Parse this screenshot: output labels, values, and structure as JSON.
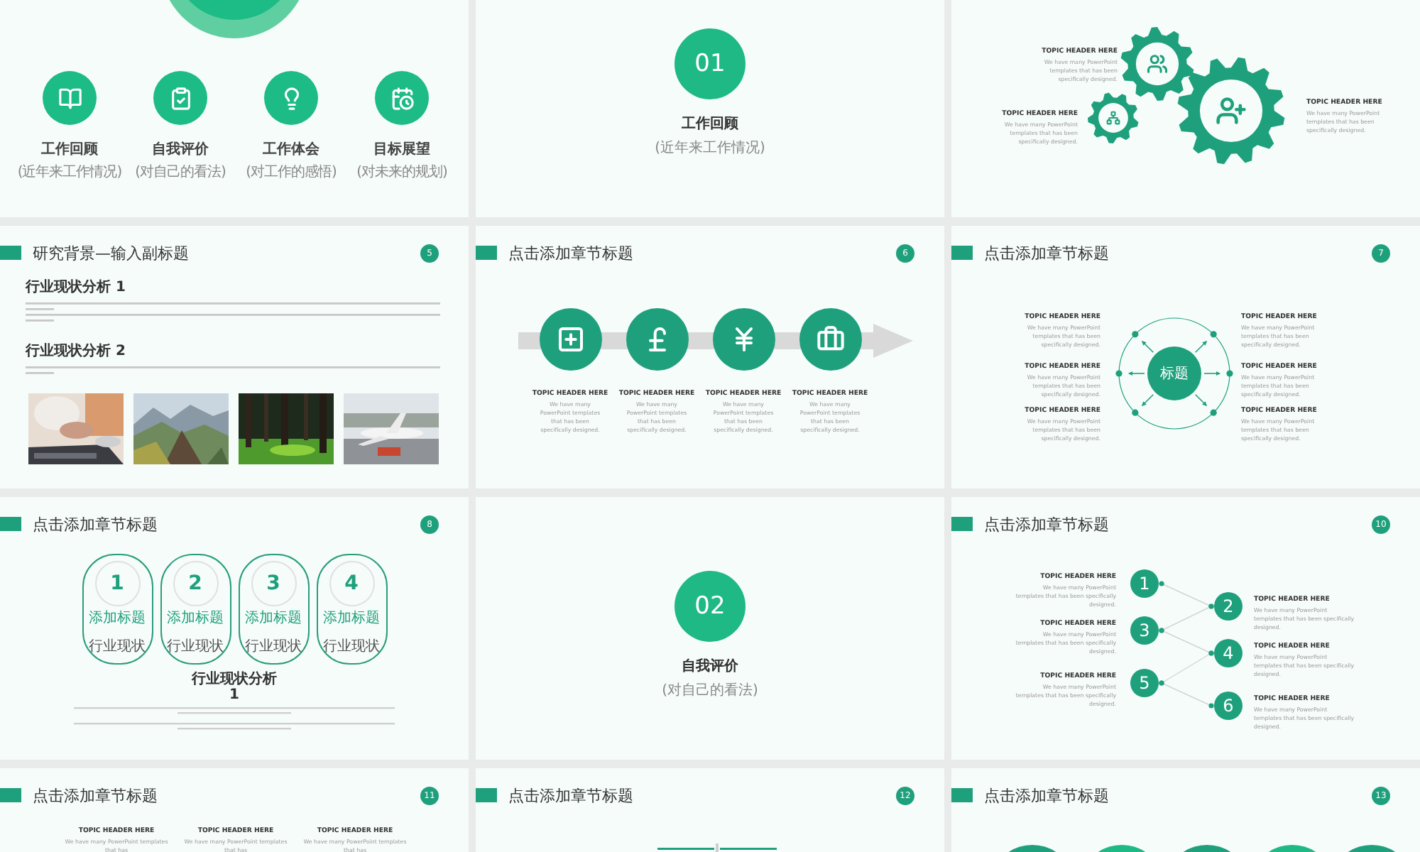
{
  "slides": [
    {
      "kind": "icons",
      "items": [
        {
          "title": "工作回顾",
          "subtitle": "(近年来工作情况)"
        },
        {
          "title": "自我评价",
          "subtitle": "(对自己的看法)"
        },
        {
          "title": "工作体会",
          "subtitle": "(对工作的感悟)"
        },
        {
          "title": "目标展望",
          "subtitle": "(对未来的规划)"
        }
      ]
    },
    {
      "kind": "section",
      "number": "01",
      "title": "工作回顾",
      "subtitle": "(近年来工作情况)"
    },
    {
      "kind": "gears",
      "topics": [
        {
          "header": "TOPIC HEADER HERE",
          "text": "We have many PowerPoint templates that has been specifically designed."
        },
        {
          "header": "TOPIC HEADER HERE",
          "text": "We have many PowerPoint templates that has been specifically designed."
        },
        {
          "header": "TOPIC HEADER HERE",
          "text": "We have many PowerPoint templates that has been specifically designed."
        }
      ]
    },
    {
      "kind": "text-photos",
      "title": "研究背景—输入副标题",
      "page": "5",
      "sections": [
        {
          "heading": "行业现状分析 1"
        },
        {
          "heading": "行业现状分析 2"
        }
      ],
      "photos": [
        {
          "kind": "picture"
        },
        {
          "kind": "picture"
        },
        {
          "kind": "picture"
        },
        {
          "kind": "picture"
        }
      ]
    },
    {
      "kind": "arrow",
      "title": "点击添加章节标题",
      "page": "6",
      "topics": [
        {
          "header": "TOPIC HEADER HERE",
          "text": "We have many PowerPoint templates that has been specifically designed."
        },
        {
          "header": "TOPIC HEADER HERE",
          "text": "We have many PowerPoint templates that has been specifically designed."
        },
        {
          "header": "TOPIC HEADER HERE",
          "text": "We have many PowerPoint templates that has been specifically designed."
        },
        {
          "header": "TOPIC HEADER HERE",
          "text": "We have many PowerPoint templates that has been specifically designed."
        }
      ]
    },
    {
      "kind": "hub",
      "title": "点击添加章节标题",
      "page": "7",
      "center": "标题",
      "topics": [
        {
          "header": "TOPIC HEADER HERE",
          "text": "We have many PowerPoint templates that has been specifically designed."
        },
        {
          "header": "TOPIC HEADER HERE",
          "text": "We have many PowerPoint templates that has been specifically designed."
        },
        {
          "header": "TOPIC HEADER HERE",
          "text": "We have many PowerPoint templates that has been specifically designed."
        },
        {
          "header": "TOPIC HEADER HERE",
          "text": "We have many PowerPoint templates that has been specifically designed."
        },
        {
          "header": "TOPIC HEADER HERE",
          "text": "We have many PowerPoint templates that has been specifically designed."
        },
        {
          "header": "TOPIC HEADER HERE",
          "text": "We have many PowerPoint templates that has been specifically designed."
        }
      ]
    },
    {
      "kind": "pills",
      "title": "点击添加章节标题",
      "page": "8",
      "pills": [
        {
          "number": "1",
          "caption": "添加标题",
          "label": "行业现状"
        },
        {
          "number": "2",
          "caption": "添加标题",
          "label": "行业现状"
        },
        {
          "number": "3",
          "caption": "添加标题",
          "label": "行业现状"
        },
        {
          "number": "4",
          "caption": "添加标题",
          "label": "行业现状"
        }
      ],
      "heading": "行业现状分析",
      "heading_number": "1"
    },
    {
      "kind": "section",
      "number": "02",
      "title": "自我评价",
      "subtitle": "(对自己的看法)"
    },
    {
      "kind": "zigzag",
      "title": "点击添加章节标题",
      "page": "10",
      "nodes": [
        {
          "number": "1",
          "header": "TOPIC HEADER HERE",
          "text": "We have many PowerPoint templates that has been specifically designed."
        },
        {
          "number": "2",
          "header": "TOPIC HEADER HERE",
          "text": "We have many PowerPoint templates that has been specifically designed."
        },
        {
          "number": "3",
          "header": "TOPIC HEADER HERE",
          "text": "We have many PowerPoint templates that has been specifically designed."
        },
        {
          "number": "4",
          "header": "TOPIC HEADER HERE",
          "text": "We have many PowerPoint templates that has been specifically designed."
        },
        {
          "number": "5",
          "header": "TOPIC HEADER HERE",
          "text": "We have many PowerPoint templates that has been specifically designed."
        },
        {
          "number": "6",
          "header": "TOPIC HEADER HERE",
          "text": "We have many PowerPoint templates that has been specifically designed."
        }
      ]
    },
    {
      "kind": "columns",
      "title": "点击添加章节标题",
      "page": "11",
      "topics": [
        {
          "header": "TOPIC HEADER HERE",
          "text": "We have many PowerPoint templates that has"
        },
        {
          "header": "TOPIC HEADER HERE",
          "text": "We have many PowerPoint templates that has"
        },
        {
          "header": "TOPIC HEADER HERE",
          "text": "We have many PowerPoint templates that has"
        }
      ]
    },
    {
      "kind": "shapes",
      "title": "点击添加章节标题",
      "page": "12"
    },
    {
      "kind": "rings",
      "title": "点击添加章节标题",
      "page": "13"
    }
  ]
}
